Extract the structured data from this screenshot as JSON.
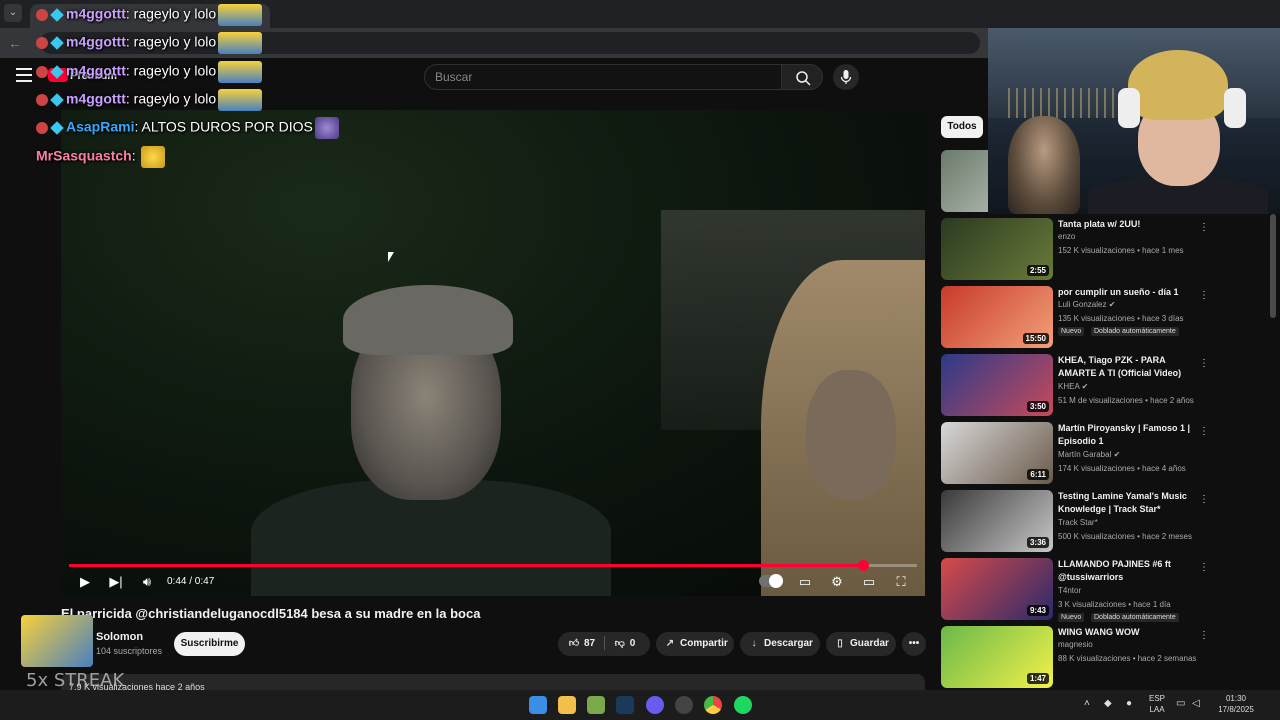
{
  "header": {
    "logo_text": "Premium",
    "search_placeholder": "Buscar"
  },
  "player": {
    "time": "0:44 / 0:47",
    "progress": 0.936,
    "colors": {
      "accent": "#ff0033"
    }
  },
  "video": {
    "title": "El parricida @christiandeluganocdl5184 besa a su madre en la boca",
    "channel": "Solomon",
    "subscribers": "104 suscriptores",
    "subscribe_label": "Suscribirme",
    "likes": "87",
    "dislikes": "0",
    "share_label": "Compartir",
    "download_label": "Descargar",
    "save_label": "Guardar",
    "more_label": "•••",
    "desc_meta": "7,9 K visualizaciones  hace 2 años"
  },
  "sidebar": {
    "chip": "Todos",
    "recs": [
      {
        "title": "Tanta plata w/ 2UU!",
        "channel": "enzo",
        "meta": "152 K visualizaciones • hace 1 mes",
        "duration": "2:55",
        "verified": false,
        "badges": []
      },
      {
        "title": "por cumplir un sueño - día 1",
        "channel": "Luli Gonzalez",
        "meta": "135 K visualizaciones • hace 3 días",
        "duration": "15:50",
        "verified": true,
        "badges": [
          "Nuevo",
          "Doblado automáticamente"
        ]
      },
      {
        "title": "KHEA, Tiago PZK - PARA AMARTE A TI (Official Video)",
        "channel": "KHEA",
        "meta": "51 M de visualizaciones • hace 2 años",
        "duration": "3:50",
        "verified": true,
        "badges": []
      },
      {
        "title": "Martín Piroyansky | Famoso 1 | Episodio 1",
        "channel": "Martín Garabal",
        "meta": "174 K visualizaciones • hace 4 años",
        "duration": "6:11",
        "verified": true,
        "badges": []
      },
      {
        "title": "Testing Lamine Yamal's Music Knowledge | Track Star*",
        "channel": "Track Star*",
        "meta": "500 K visualizaciones • hace 2 meses",
        "duration": "3:36",
        "verified": false,
        "badges": []
      },
      {
        "title": "LLAMANDO PAJINES #6 ft @tussiwarriors",
        "channel": "T4ntor",
        "meta": "3 K visualizaciones • hace 1 día",
        "duration": "9:43",
        "verified": false,
        "badges": [
          "Nuevo",
          "Doblado automáticamente"
        ]
      },
      {
        "title": "WING WANG WOW",
        "channel": "magnesio",
        "meta": "88 K visualizaciones • hace 2 semanas",
        "duration": "1:47",
        "verified": false,
        "badges": []
      }
    ]
  },
  "chat": [
    {
      "user": "m4ggottt",
      "msg": "rageylo y lolo",
      "user_color": "#c9a0ff",
      "emote": "minion"
    },
    {
      "user": "m4ggottt",
      "msg": "rageylo y lolo",
      "user_color": "#c9a0ff",
      "emote": "minion"
    },
    {
      "user": "m4ggottt",
      "msg": "rageylo y lolo",
      "user_color": "#c9a0ff",
      "emote": "minion"
    },
    {
      "user": "m4ggottt",
      "msg": "rageylo y lolo",
      "user_color": "#c9a0ff",
      "emote": "minion"
    },
    {
      "user": "AsapRami",
      "msg": "ALTOS DUROS POR DIOS",
      "user_color": "#39a6ff",
      "emote": "purple-blob"
    },
    {
      "user": "MrSasquastch",
      "msg": "",
      "user_color": "#ff7ea6",
      "emote": "yellow-blob"
    }
  ],
  "overlay": {
    "streak": "5x STREAK"
  },
  "taskbar": {
    "lang_top": "ESP",
    "lang_bottom": "LAA",
    "time": "01:30",
    "date": "17/8/2025"
  }
}
